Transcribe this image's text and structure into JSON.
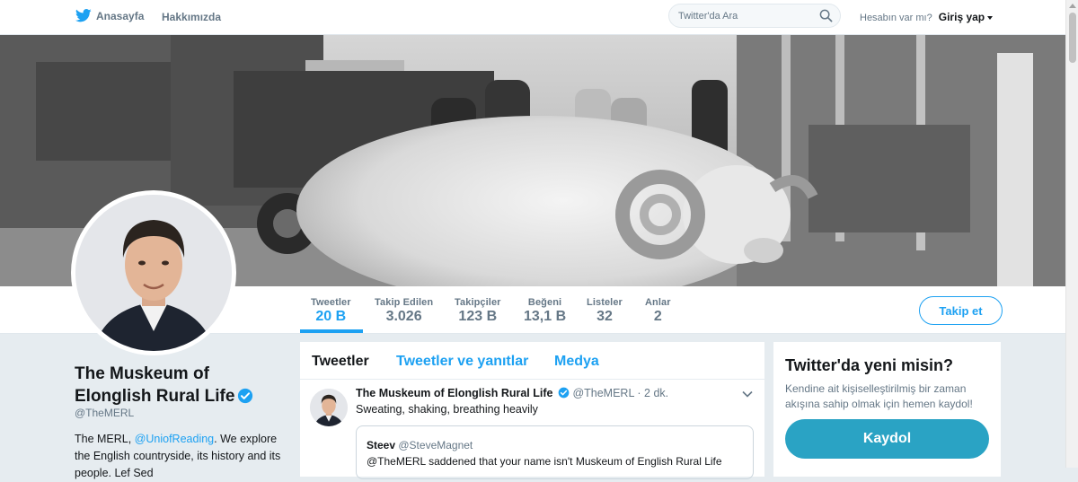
{
  "topnav": {
    "home_label": "Anasayfa",
    "about_label": "Hakkımızda",
    "search_placeholder": "Twitter'da Ara",
    "account_prompt": "Hesabın var mı?",
    "login_label": "Giriş yap"
  },
  "profile_nav": {
    "stats": [
      {
        "label": "Tweetler",
        "value": "20 B"
      },
      {
        "label": "Takip Edilen",
        "value": "3.026"
      },
      {
        "label": "Takipçiler",
        "value": "123 B"
      },
      {
        "label": "Beğeni",
        "value": "13,1 B"
      },
      {
        "label": "Listeler",
        "value": "32"
      },
      {
        "label": "Anlar",
        "value": "2"
      }
    ],
    "follow_label": "Takip et"
  },
  "profile": {
    "name": "The Muskeum of Elonglish Rural Life",
    "handle": "@TheMERL",
    "bio_prefix": "The MERL, ",
    "bio_mention": "@UniofReading",
    "bio_rest": ". We explore the English countryside, its history and its people. Lef Sed"
  },
  "timeline": {
    "tabs": [
      "Tweetler",
      "Tweetler ve yanıtlar",
      "Medya"
    ],
    "tweet": {
      "name": "The Muskeum of Elonglish Rural Life",
      "handle": "@TheMERL",
      "time": "· 2 dk.",
      "text": "Sweating, shaking, breathing heavily",
      "quote": {
        "name": "Steev",
        "handle": "@SteveMagnet",
        "text": "@TheMERL saddened that your name isn't Muskeum of English Rural Life"
      }
    }
  },
  "signup": {
    "title": "Twitter'da yeni misin?",
    "description": "Kendine ait kişiselleştirilmiş bir zaman akışına sahip olmak için hemen kaydol!",
    "button_label": "Kaydol"
  },
  "colors": {
    "accent": "#1da1f2",
    "signup_button": "#2aa3c4",
    "background": "#e6ecf0"
  }
}
